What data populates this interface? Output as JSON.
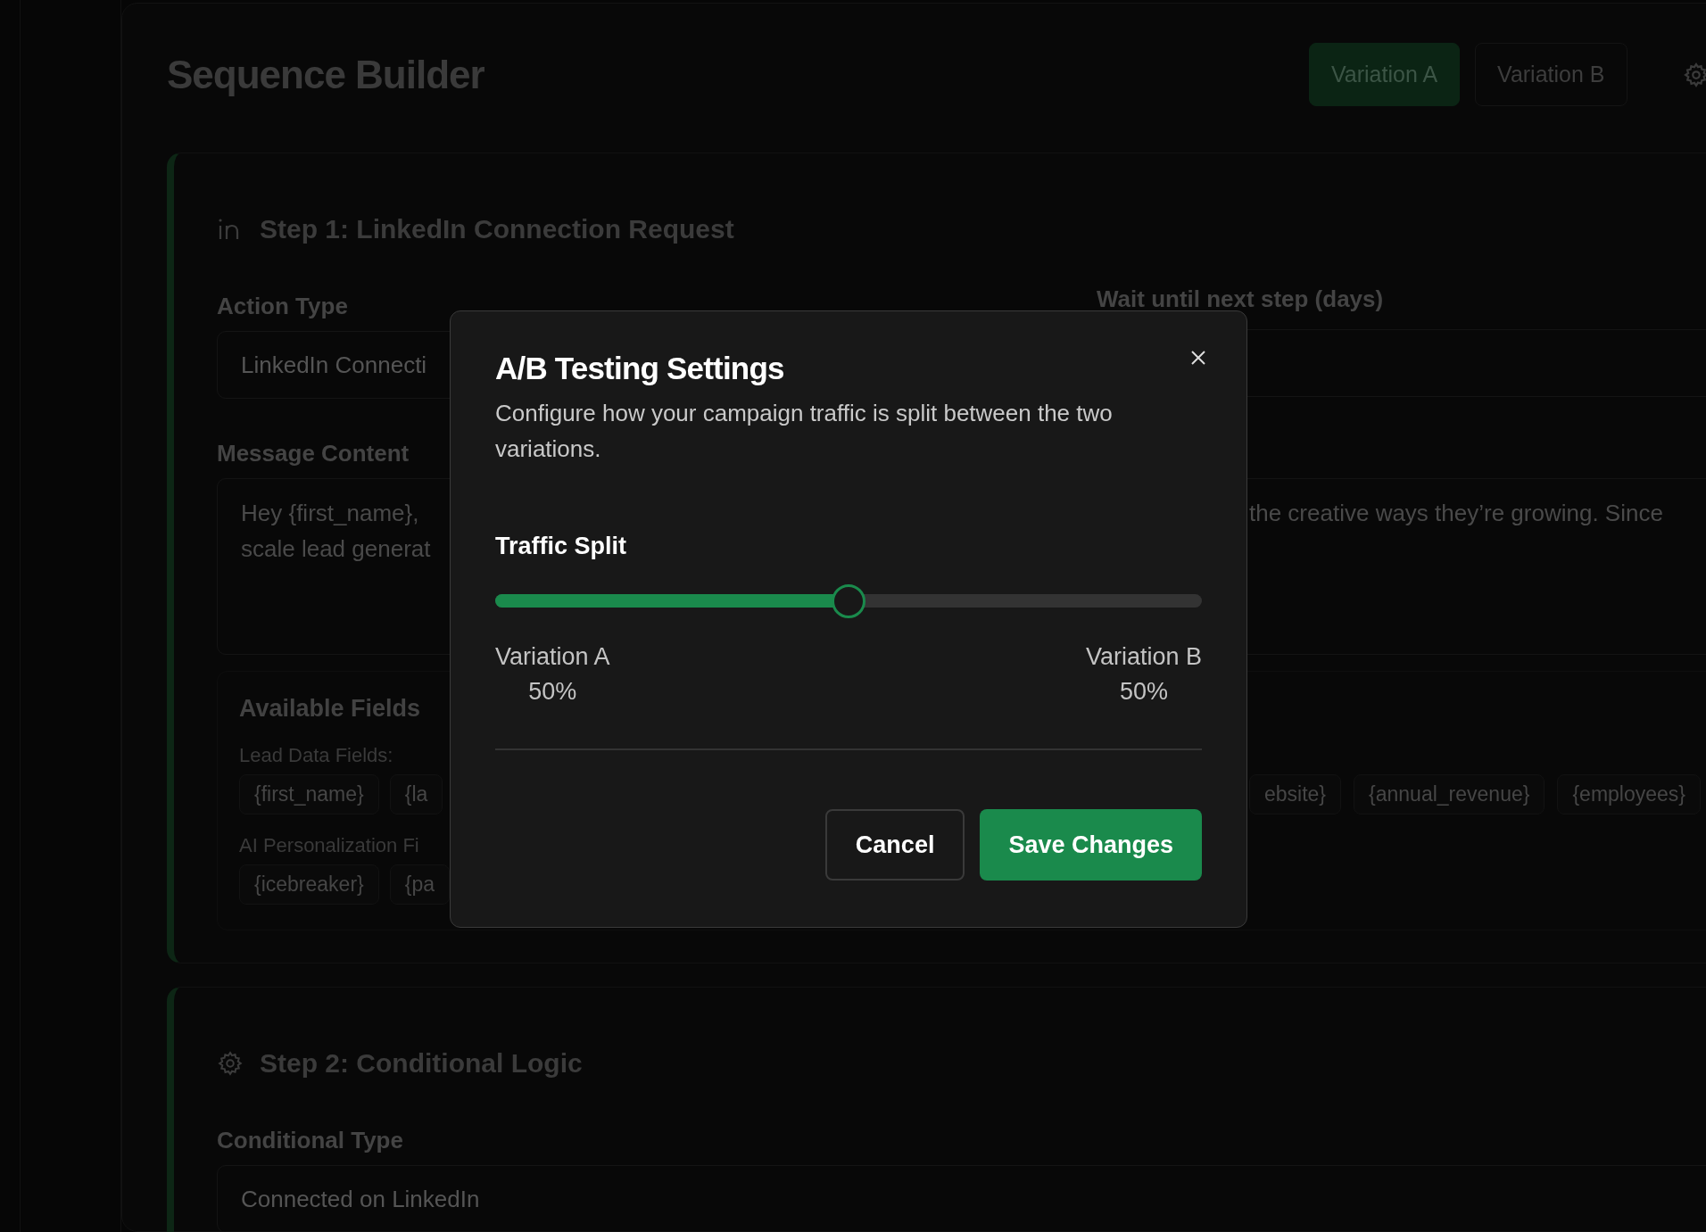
{
  "page": {
    "title": "Sequence Builder",
    "variations": [
      {
        "label": "Variation A",
        "selected": true
      },
      {
        "label": "Variation B",
        "selected": false
      }
    ]
  },
  "steps": [
    {
      "kind": "linkedin",
      "title": "Step 1: LinkedIn Connection Request",
      "action_type": {
        "label": "Action Type",
        "value": "LinkedIn Connecti"
      },
      "wait": {
        "label": "Wait until next step (days)"
      },
      "message": {
        "label": "Message Content",
        "left_lines": [
          "Hey {first_name},",
          "scale lead generat"
        ],
        "right_lines": [
          "the creative ways they’re growing. Since"
        ]
      },
      "fields": {
        "title": "Available Fields",
        "groups": [
          {
            "label": "Lead Data Fields:",
            "left_chips": [
              "{first_name}",
              "{la"
            ],
            "right_chips": [
              "ebsite}",
              "{annual_revenue}",
              "{employees}"
            ]
          },
          {
            "label": "AI Personalization Fi",
            "left_chips": [
              "{icebreaker}",
              "{pa"
            ]
          }
        ]
      }
    },
    {
      "kind": "logic",
      "title": "Step 2: Conditional Logic",
      "conditional": {
        "label": "Conditional Type",
        "value": "Connected on LinkedIn"
      }
    }
  ],
  "dialog": {
    "title": "A/B Testing Settings",
    "description": "Configure how your campaign traffic is split between the two variations.",
    "slider": {
      "label": "Traffic Split",
      "level": 0.5
    },
    "split": [
      {
        "name": "Variation A",
        "value": "50%"
      },
      {
        "name": "Variation B",
        "value": "50%"
      }
    ],
    "buttons": [
      {
        "label": "Cancel",
        "kind": "secondary"
      },
      {
        "label": "Save Changes",
        "kind": "primary"
      }
    ]
  }
}
